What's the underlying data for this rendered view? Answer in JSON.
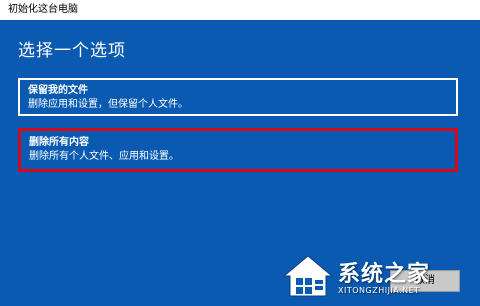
{
  "window": {
    "title": "初始化这台电脑"
  },
  "main": {
    "heading": "选择一个选项",
    "options": [
      {
        "title": "保留我的文件",
        "description": "删除应用和设置，但保留个人文件。"
      },
      {
        "title": "删除所有内容",
        "description": "删除所有个人文件、应用和设置。"
      }
    ],
    "cancel_label": "取消"
  },
  "watermark": {
    "brand": "系统之家",
    "url": "XITONGZHIJIA.NET"
  },
  "colors": {
    "background": "#0a5ab2",
    "highlight_border": "#d40a1c",
    "text": "#ffffff"
  }
}
